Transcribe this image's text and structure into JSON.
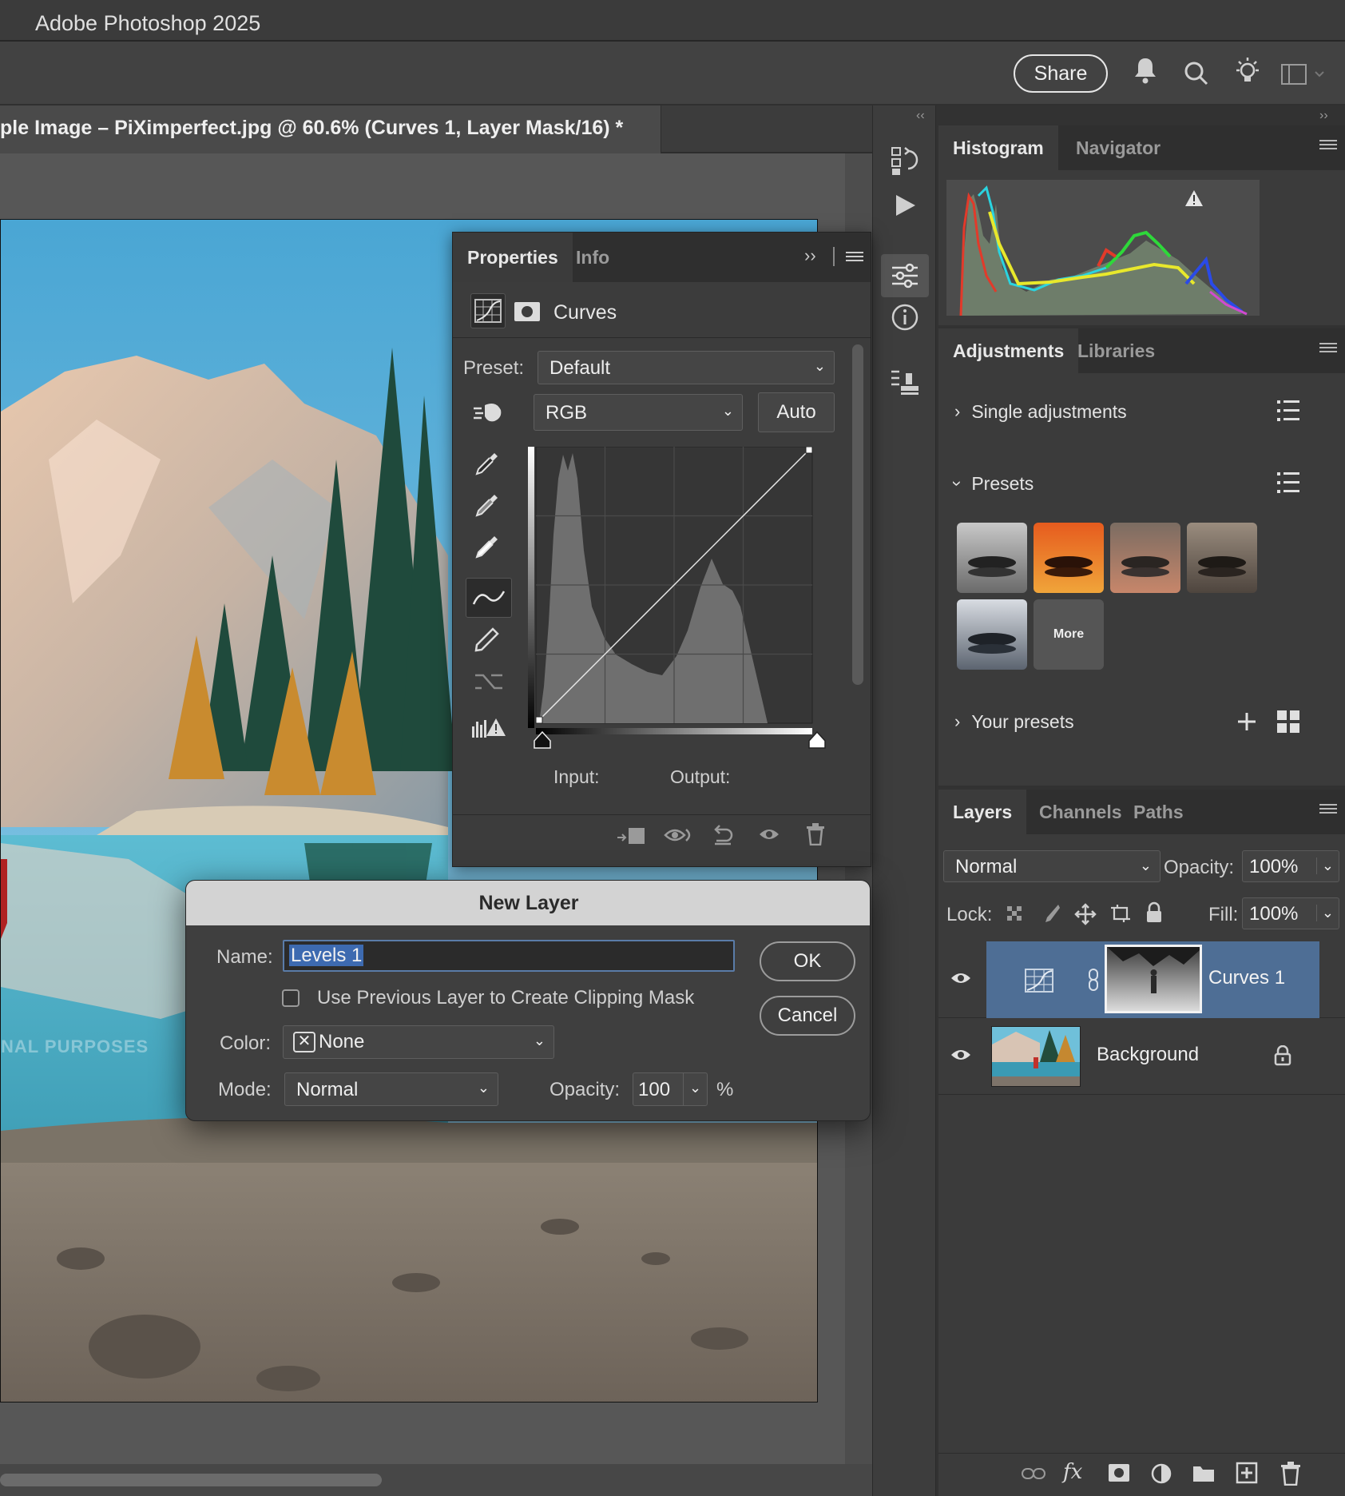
{
  "app": {
    "title": "Adobe Photoshop 2025"
  },
  "toolbar": {
    "share_label": "Share"
  },
  "document": {
    "tab_title": "ple Image – PiXimperfect.jpg @ 60.6% (Curves 1, Layer Mask/16) *",
    "watermark_text": "NAL PURPOSES"
  },
  "histogram_panel": {
    "tabs": [
      "Histogram",
      "Navigator"
    ]
  },
  "adjustments_panel": {
    "tabs": [
      "Adjustments",
      "Libraries"
    ],
    "single_adjustments_label": "Single adjustments",
    "presets_label": "Presets",
    "more_label": "More",
    "your_presets_label": "Your presets"
  },
  "layers_panel": {
    "tabs": [
      "Layers",
      "Channels",
      "Paths"
    ],
    "blend_mode": "Normal",
    "opacity_label": "Opacity:",
    "opacity_value": "100%",
    "lock_label": "Lock:",
    "fill_label": "Fill:",
    "fill_value": "100%",
    "layers": [
      {
        "name": "Curves 1",
        "selected": true
      },
      {
        "name": "Background",
        "locked": true
      }
    ]
  },
  "properties_panel": {
    "tabs": [
      "Properties",
      "Info"
    ],
    "title": "Curves",
    "preset_label": "Preset:",
    "preset_value": "Default",
    "channel_value": "RGB",
    "auto_label": "Auto",
    "input_label": "Input:",
    "output_label": "Output:"
  },
  "new_layer_dialog": {
    "title": "New Layer",
    "name_label": "Name:",
    "name_value": "Levels 1",
    "clipping_label": "Use Previous Layer to Create Clipping Mask",
    "clipping_checked": false,
    "color_label": "Color:",
    "color_value": "None",
    "mode_label": "Mode:",
    "mode_value": "Normal",
    "opacity_label": "Opacity:",
    "opacity_value": "100",
    "percent": "%",
    "ok_label": "OK",
    "cancel_label": "Cancel"
  },
  "colors": {
    "accent": "#5a7ca8",
    "selected_layer": "#4e6e95",
    "panel_bg": "#3b3b3b"
  }
}
